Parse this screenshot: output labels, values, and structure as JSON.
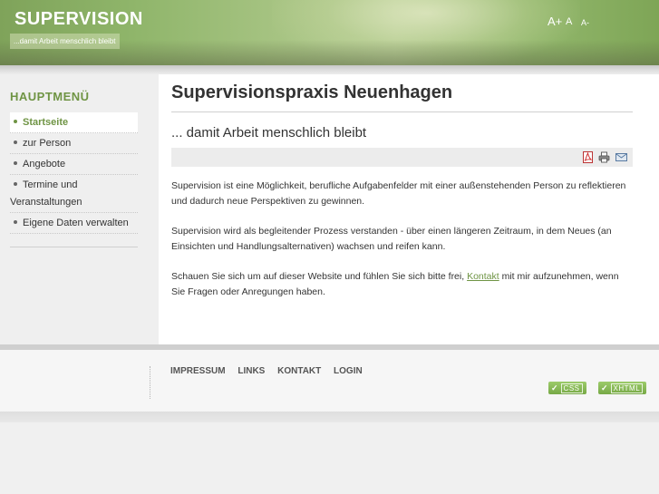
{
  "header": {
    "site_title": "SUPERVISION",
    "tagline": "...damit Arbeit menschlich bleibt",
    "font_controls": {
      "large": "A+",
      "normal": "A",
      "small": "A-"
    }
  },
  "sidebar": {
    "menu_title": "HAUPTMENÜ",
    "items": [
      {
        "label": "Startseite",
        "active": true
      },
      {
        "label": "zur Person"
      },
      {
        "label": "Angebote"
      },
      {
        "label": "Termine und Veranstaltungen"
      },
      {
        "label": "Eigene Daten verwalten"
      }
    ]
  },
  "main": {
    "page_title": "Supervisionspraxis Neuenhagen",
    "article_title": "... damit Arbeit menschlich bleibt",
    "toolbar_icons": [
      "pdf-icon",
      "print-icon",
      "email-icon"
    ],
    "paragraphs": {
      "p1": "Supervision ist eine Möglichkeit, berufliche Aufgabenfelder mit einer außenstehenden Person zu reflektieren und dadurch neue Perspektiven zu gewinnen.",
      "p2": "Supervision wird als begleitender Prozess verstanden - über einen längeren Zeitraum, in dem Neues (an Einsichten und Handlungsalternativen) wachsen und reifen kann.",
      "p3_before": "Schauen Sie sich um auf dieser Website und fühlen Sie sich bitte frei, ",
      "p3_link": "Kontakt",
      "p3_after": " mit mir aufzunehmen, wenn Sie Fragen oder Anregungen haben."
    }
  },
  "footer": {
    "nav": [
      "IMPRESSUM",
      "LINKS",
      "KONTAKT",
      "LOGIN"
    ],
    "badges": {
      "css": "CSS",
      "xhtml": "XHTML"
    }
  },
  "colors": {
    "accent_green": "#6f9444",
    "header_green": "#8fb56a"
  }
}
